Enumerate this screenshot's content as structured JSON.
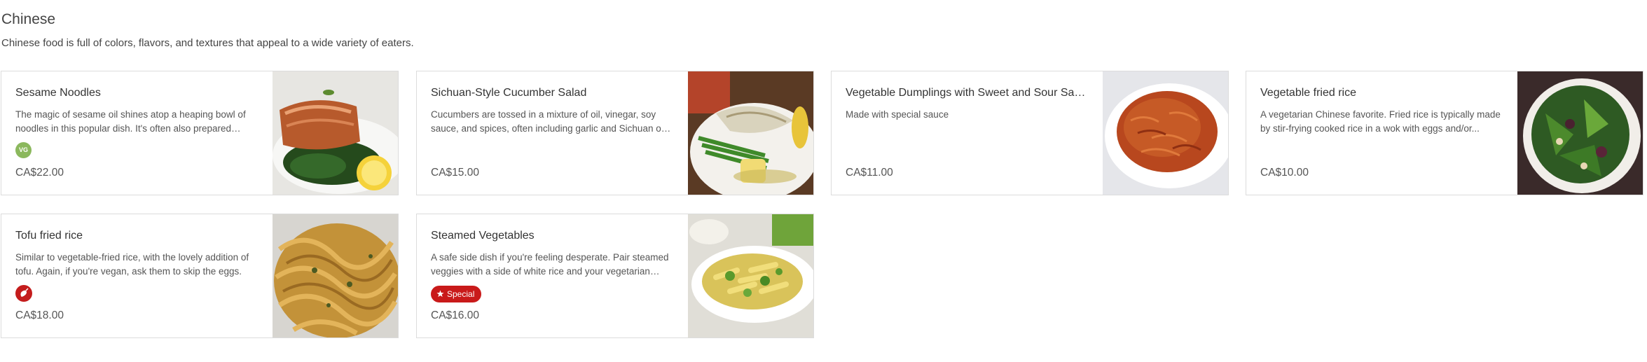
{
  "section": {
    "title": "Chinese",
    "description": "Chinese food is full of colors, flavors, and textures that appeal to a wide variety of eaters."
  },
  "badges": {
    "vegan_label": "VG",
    "special_label": "Special"
  },
  "colors": {
    "vegan_badge": "#8bb85d",
    "spicy_badge": "#c41c1c",
    "special_badge": "#c91a1a",
    "card_border": "#dcdcdc"
  },
  "items": [
    {
      "name": "Sesame Noodles",
      "description": "The magic of sesame oil shines atop a heaping bowl of noodles in this popular dish. It's often also prepared with...",
      "price": "CA$22.00",
      "badge": "vegan-badge",
      "image": "salmon-spinach-lemon-photo"
    },
    {
      "name": "Sichuan-Style Cucumber Salad",
      "description": "Cucumbers are tossed in a mixture of oil, vinegar, soy sauce, and spices, often including garlic and Sichuan or re...",
      "price": "CA$15.00",
      "badge": "",
      "image": "fish-green-beans-potato-photo"
    },
    {
      "name": "Vegetable Dumplings with Sweet and Sour Sauce",
      "description": "Made with special sauce",
      "price": "CA$11.00",
      "badge": "",
      "image": "tomato-rice-bowl-photo"
    },
    {
      "name": "Vegetable fried rice",
      "description": "A vegetarian Chinese favorite. Fried rice is typically made by stir-frying cooked rice in a wok with eggs and/or...",
      "price": "CA$10.00",
      "badge": "",
      "image": "green-salad-photo"
    },
    {
      "name": "Tofu fried rice",
      "description": "Similar to vegetable-fried rice, with the lovely addition of tofu. Again, if you're vegan, ask them to skip the eggs.",
      "price": "CA$18.00",
      "badge": "spicy-badge",
      "image": "pesto-tagliatelle-photo"
    },
    {
      "name": "Steamed Vegetables",
      "description": "A safe side dish if you're feeling desperate. Pair steamed veggies with a side of white rice and your vegetarian sauc...",
      "price": "CA$16.00",
      "badge": "special-badge",
      "image": "penne-zucchini-photo"
    }
  ]
}
